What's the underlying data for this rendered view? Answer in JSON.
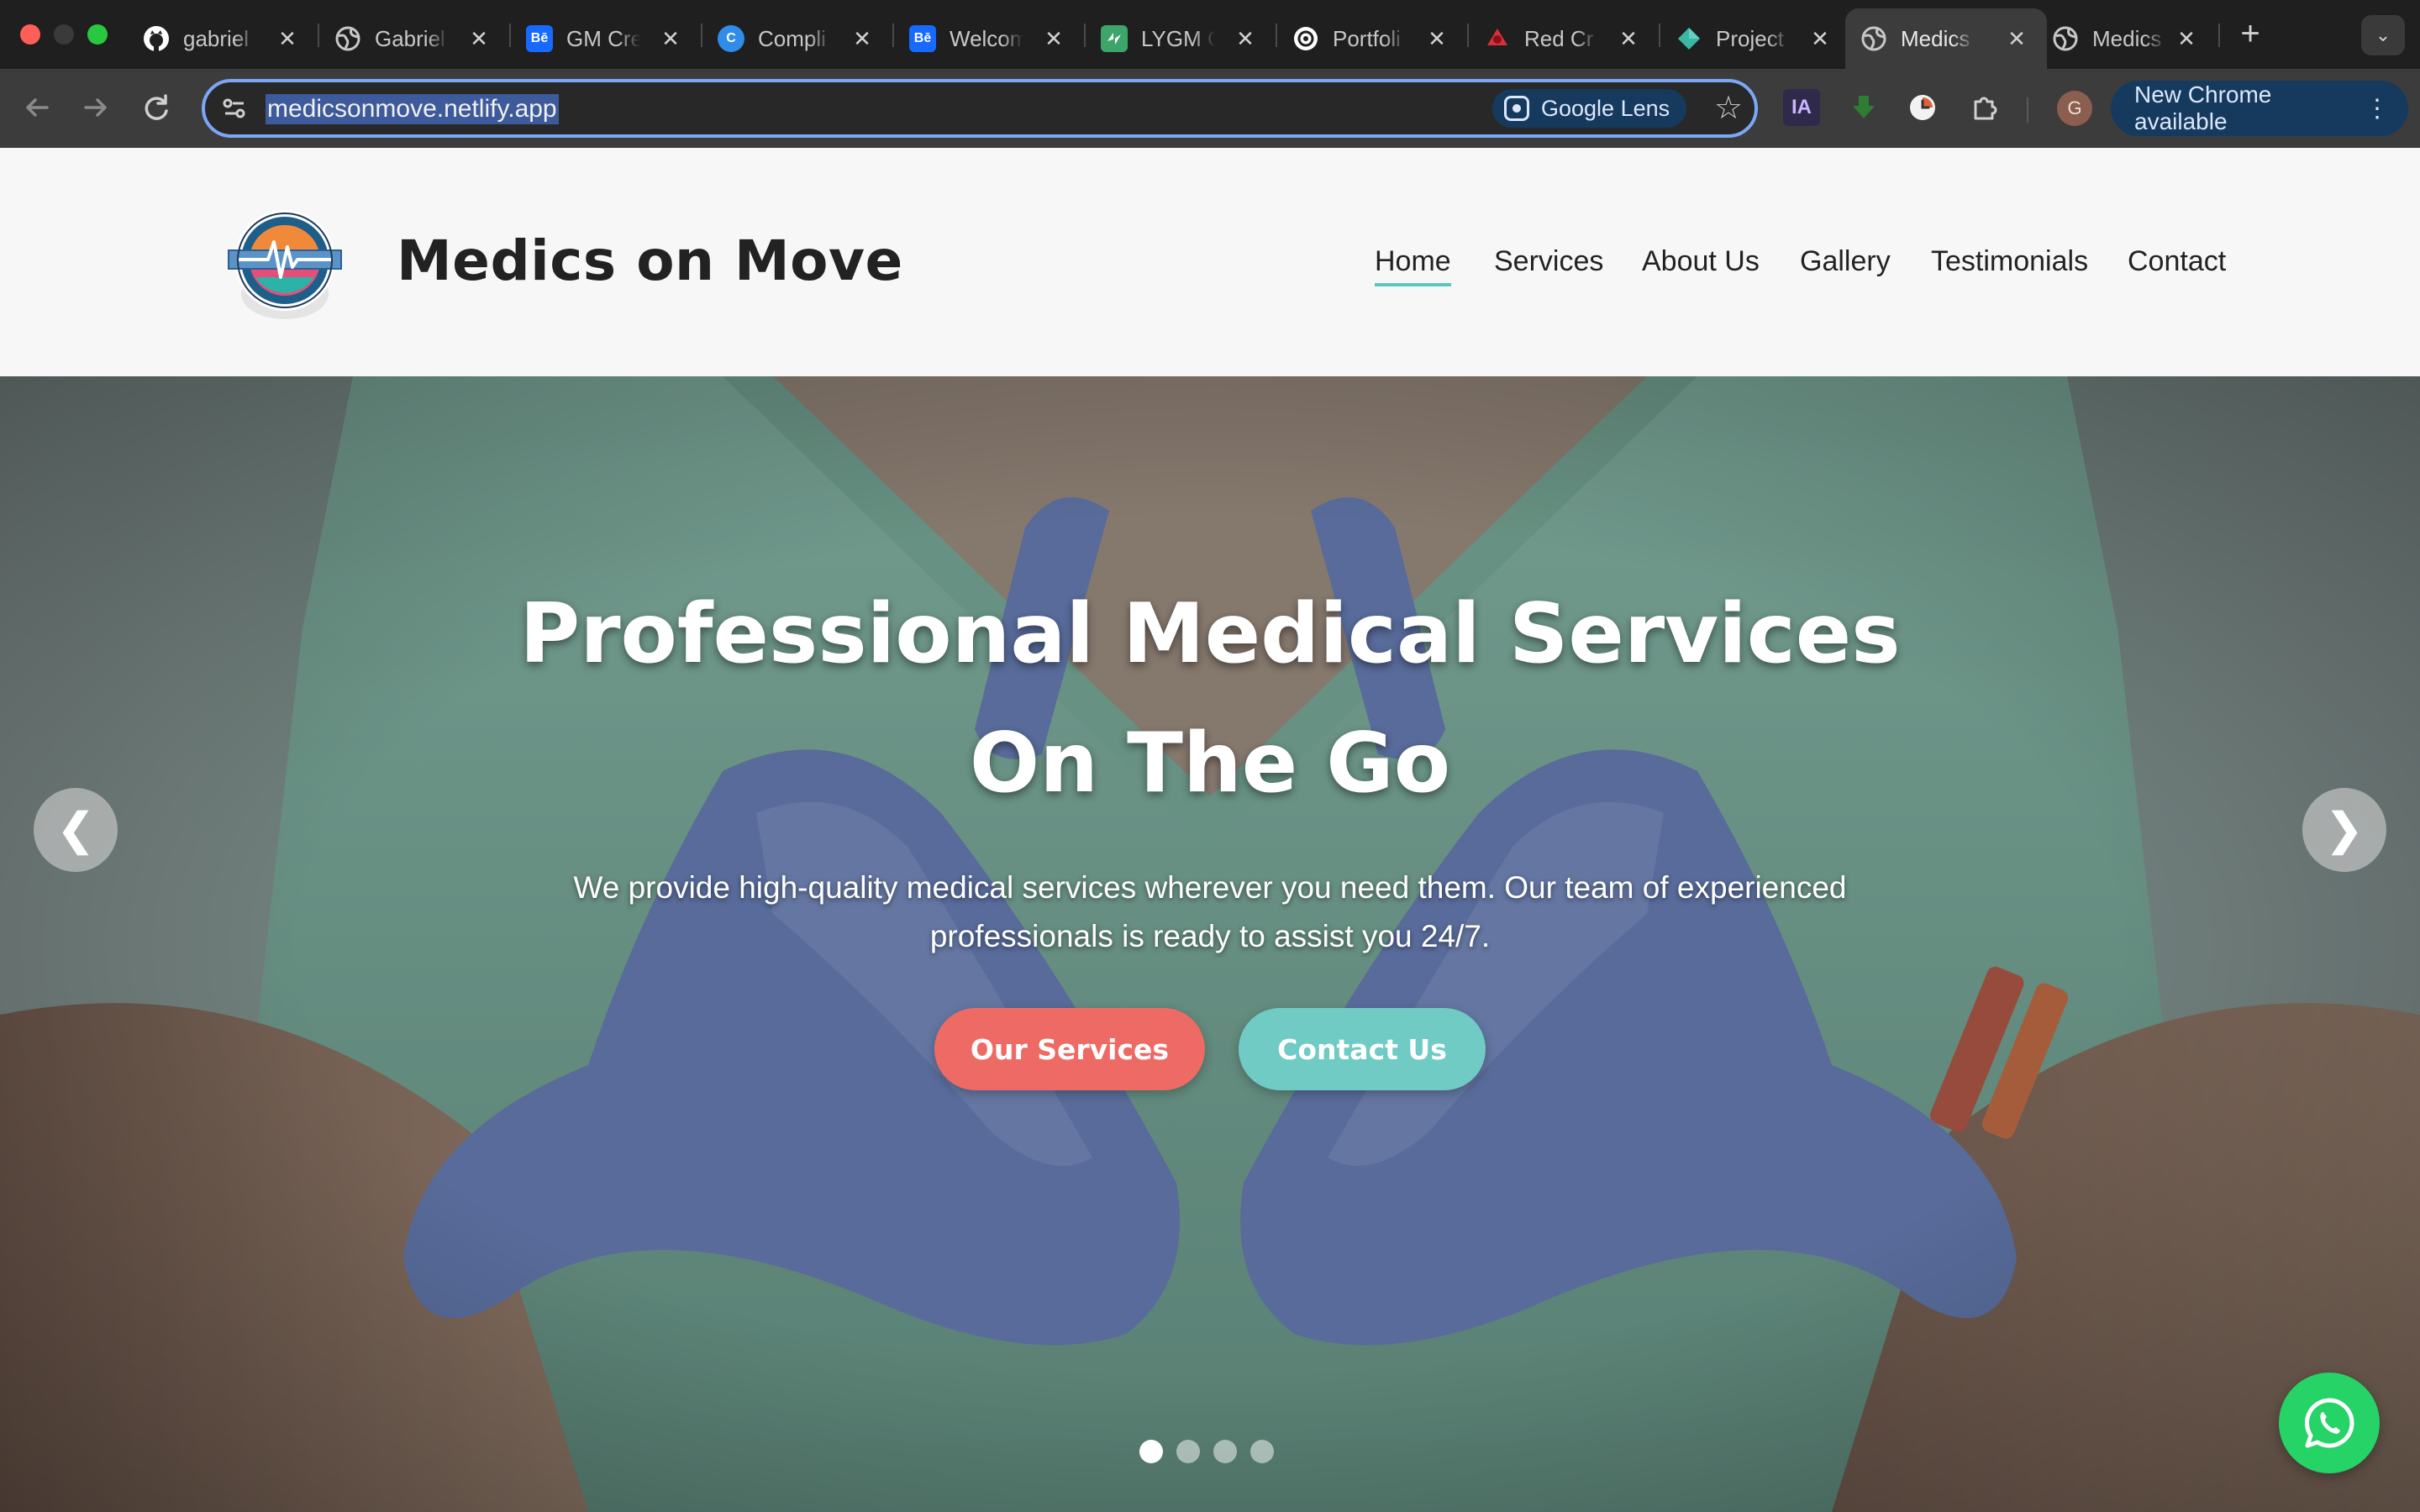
{
  "browser": {
    "tabs": [
      {
        "title": "gabriel",
        "icon": "github-icon"
      },
      {
        "title": "Gabriel",
        "icon": "globe-icon"
      },
      {
        "title": "GM Cre",
        "icon": "behance-icon"
      },
      {
        "title": "Compli",
        "icon": "canva-icon"
      },
      {
        "title": "Welcom",
        "icon": "behance-icon"
      },
      {
        "title": "LYGM C",
        "icon": "app-icon"
      },
      {
        "title": "Portfoli",
        "icon": "openai-icon"
      },
      {
        "title": "Red Cr",
        "icon": "red-app-icon"
      },
      {
        "title": "Project",
        "icon": "diamond-icon"
      },
      {
        "title": "Medics",
        "icon": "globe-icon",
        "active": true
      },
      {
        "title": "Medics",
        "icon": "globe-icon"
      }
    ],
    "favicon_labels": {
      "behance": "Bē",
      "canva": "C"
    },
    "close_glyph": "✕",
    "new_tab_glyph": "+",
    "tab_search_glyph": "⌄",
    "url": "medicsonmove.netlify.app",
    "lens_label": "Google Lens",
    "extension_ia_label": "IA",
    "profile_initial": "G",
    "update_label": "New Chrome available"
  },
  "site": {
    "brand": "Medics on Move",
    "nav": [
      {
        "label": "Home",
        "active": true
      },
      {
        "label": "Services"
      },
      {
        "label": "About Us"
      },
      {
        "label": "Gallery"
      },
      {
        "label": "Testimonials"
      },
      {
        "label": "Contact"
      }
    ],
    "hero": {
      "title_line1": "Professional Medical Services",
      "title_line2": "On The Go",
      "description": "We provide high-quality medical services wherever you need them. Our team of experienced professionals is ready to assist you 24/7.",
      "primary_button": "Our Services",
      "secondary_button": "Contact Us",
      "prev_glyph": "❮",
      "next_glyph": "❯",
      "slide_count": 4,
      "active_slide": 1
    }
  },
  "colors": {
    "accent_coral": "#ee6b65",
    "accent_teal": "#6fcbc3",
    "whatsapp_green": "#25d366",
    "omnibox_focus": "#7ca7f5"
  }
}
